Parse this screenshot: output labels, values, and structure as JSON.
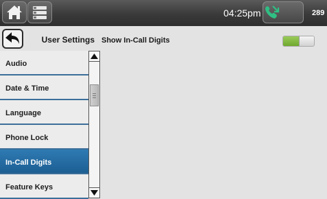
{
  "status_bar": {
    "time": "04:25pm",
    "line_number": "289",
    "icons": [
      "home-icon",
      "menu-icon",
      "phone-icon"
    ]
  },
  "header": {
    "title": "User Settings",
    "back_icon": "back-arrow-icon"
  },
  "sidebar": {
    "items": [
      {
        "label": "Audio",
        "selected": false
      },
      {
        "label": "Date & Time",
        "selected": false
      },
      {
        "label": "Language",
        "selected": false
      },
      {
        "label": "Phone Lock",
        "selected": false
      },
      {
        "label": "In-Call Digits",
        "selected": true
      },
      {
        "label": "Feature Keys",
        "selected": false
      }
    ]
  },
  "content": {
    "setting_label": "Show In-Call Digits",
    "toggle_on": true
  },
  "colors": {
    "selected_item": "#2273ad",
    "toggle_on": "#7fb43c",
    "divider": "#3b6e99"
  }
}
